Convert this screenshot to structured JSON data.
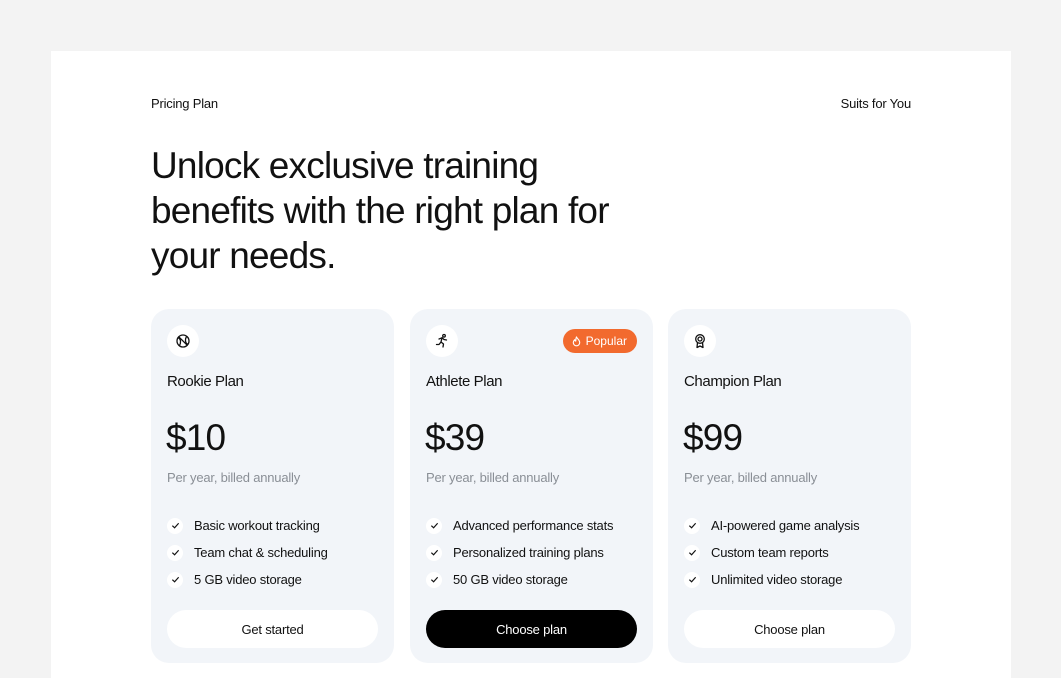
{
  "header": {
    "eyebrow_left": "Pricing Plan",
    "eyebrow_right": "Suits for You",
    "headline": "Unlock exclusive training benefits with the right plan for your needs."
  },
  "colors": {
    "accent": "#f26a2e",
    "card_bg": "#f2f5f9",
    "primary_button": "#000000"
  },
  "plans": [
    {
      "icon": "basketball-icon",
      "name": "Rookie Plan",
      "price": "$10",
      "billing": "Per year, billed annually",
      "features": [
        "Basic workout tracking",
        "Team chat & scheduling",
        "5 GB video storage"
      ],
      "cta": "Get started"
    },
    {
      "icon": "running-person-icon",
      "name": "Athlete Plan",
      "badge": "Popular",
      "badge_icon": "flame-icon",
      "price": "$39",
      "billing": "Per year, billed annually",
      "features": [
        "Advanced performance stats",
        "Personalized training plans",
        "50 GB video storage"
      ],
      "cta": "Choose plan"
    },
    {
      "icon": "medal-icon",
      "name": "Champion Plan",
      "price": "$99",
      "billing": "Per year, billed annually",
      "features": [
        "AI-powered game analysis",
        "Custom team reports",
        "Unlimited video storage"
      ],
      "cta": "Choose plan"
    }
  ]
}
